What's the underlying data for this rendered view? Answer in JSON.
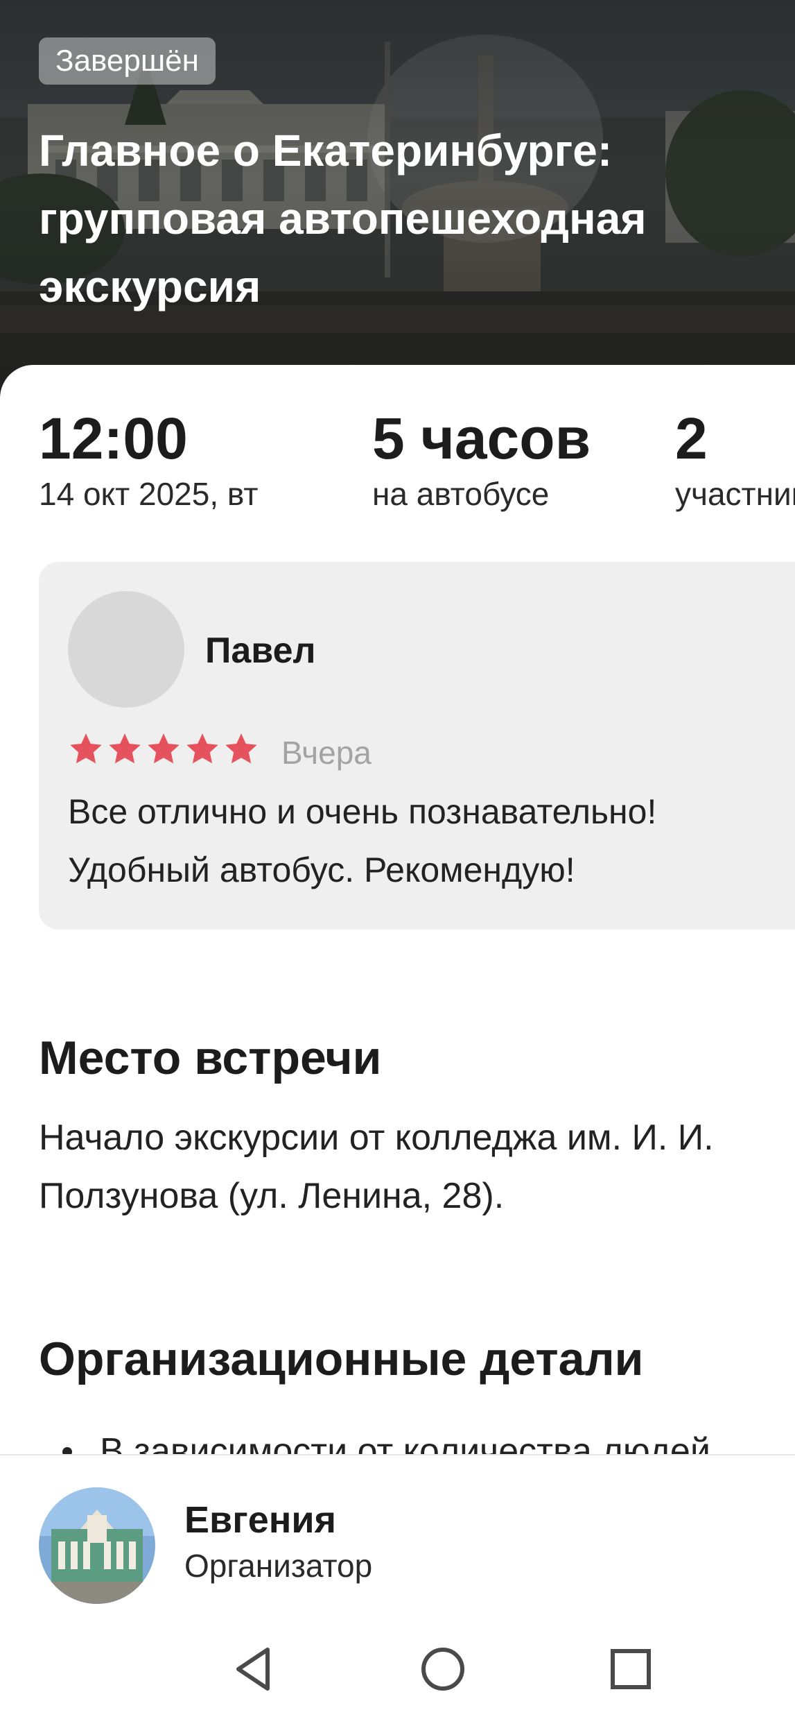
{
  "hero": {
    "status": "Завершён",
    "title": "Главное о Екатеринбурге: групповая автопешеходная экскурсия"
  },
  "stats": [
    {
      "value": "12:00",
      "label": "14 окт 2025, вт"
    },
    {
      "value": "5 часов",
      "label": "на автобусе"
    },
    {
      "value": "2",
      "label": "участника"
    }
  ],
  "review": {
    "author": "Павел",
    "rating": 5,
    "date": "Вчера",
    "text": "Все отлично и очень познавательно!\nУдобный автобус. Рекомендую!"
  },
  "meeting": {
    "title": "Место встречи",
    "line1": "Начало экскурсии от колледжа им. И. И.",
    "line2": "Ползунова (ул. Ленина, 28)."
  },
  "details": {
    "title": "Организационные детали",
    "items": [
      "В зависимости от количества людей"
    ]
  },
  "organizer": {
    "name": "Евгения",
    "role": "Организатор"
  },
  "nav": {
    "back": "back-icon",
    "home": "home-icon",
    "recents": "recents-icon"
  },
  "colors": {
    "star": "#E5525E",
    "card_bg": "#EFEFEF",
    "muted": "#A3A3A3",
    "text": "#1C1C1C"
  }
}
